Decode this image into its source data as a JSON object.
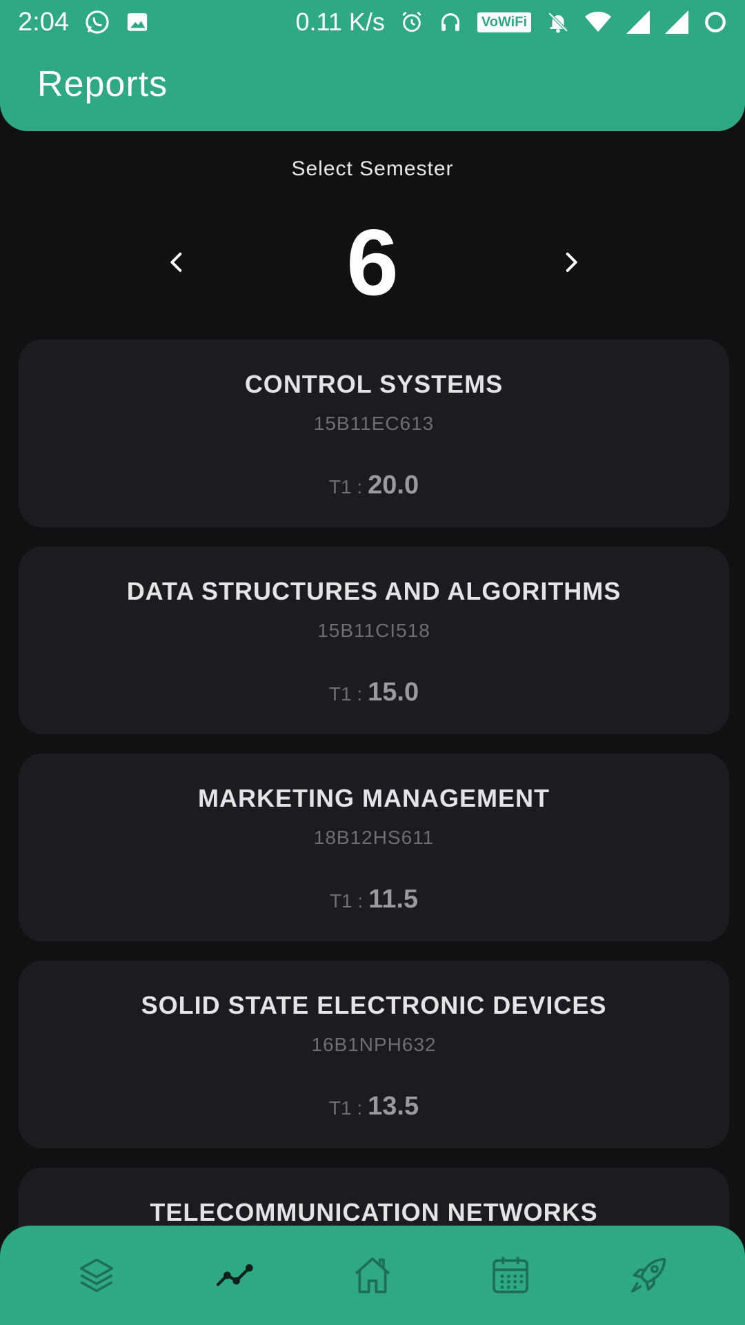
{
  "status_bar": {
    "time": "2:04",
    "network_speed": "0.11 K/s",
    "vowifi": "VoWiFi",
    "icons": [
      "whatsapp-icon",
      "gallery-icon",
      "alarm-icon",
      "headset-icon",
      "vowifi-icon",
      "muted-bell-icon",
      "wifi-icon",
      "signal-icon",
      "signal-icon",
      "battery-ring-icon"
    ]
  },
  "header": {
    "title": "Reports"
  },
  "semester": {
    "label": "Select Semester",
    "value": "6"
  },
  "subjects": [
    {
      "name": "CONTROL SYSTEMS",
      "code": "15B11EC613",
      "score_label": "T1 :",
      "score": "20.0"
    },
    {
      "name": "DATA STRUCTURES AND ALGORITHMS",
      "code": "15B11CI518",
      "score_label": "T1 :",
      "score": "15.0"
    },
    {
      "name": "MARKETING MANAGEMENT",
      "code": "18B12HS611",
      "score_label": "T1 :",
      "score": "11.5"
    },
    {
      "name": "SOLID STATE ELECTRONIC DEVICES",
      "code": "16B1NPH632",
      "score_label": "T1 :",
      "score": "13.5"
    },
    {
      "name": "TELECOMMUNICATION NETWORKS"
    }
  ],
  "bottom_nav": {
    "items": [
      "layers-icon",
      "trend-chart-icon",
      "home-icon",
      "calendar-icon",
      "rocket-icon"
    ],
    "active": "trend-chart-icon"
  },
  "colors": {
    "accent": "#2ea984",
    "background": "#111111",
    "card": "#1c1c20",
    "nav_icon": "#1e6e56",
    "nav_icon_active": "#0f1f1a"
  }
}
